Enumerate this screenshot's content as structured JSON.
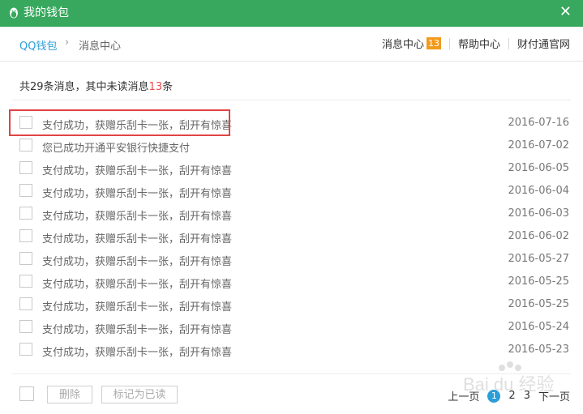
{
  "window": {
    "title": "我的钱包",
    "close_label": "✕"
  },
  "nav": {
    "breadcrumb": {
      "home": "QQ钱包",
      "sep": "›",
      "current": "消息中心"
    },
    "message_center": "消息中心",
    "message_badge": "13",
    "help_center": "帮助中心",
    "tenpay": "财付通官网"
  },
  "summary": {
    "prefix": "共29条消息，其中未读消息",
    "unread": "13",
    "suffix": "条"
  },
  "messages": [
    {
      "text": "支付成功，获赠乐刮卡一张，刮开有惊喜",
      "date": "2016-07-16"
    },
    {
      "text": "您已成功开通平安银行快捷支付",
      "date": "2016-07-02"
    },
    {
      "text": "支付成功，获赠乐刮卡一张，刮开有惊喜",
      "date": "2016-06-05"
    },
    {
      "text": "支付成功，获赠乐刮卡一张，刮开有惊喜",
      "date": "2016-06-04"
    },
    {
      "text": "支付成功，获赠乐刮卡一张，刮开有惊喜",
      "date": "2016-06-03"
    },
    {
      "text": "支付成功，获赠乐刮卡一张，刮开有惊喜",
      "date": "2016-06-02"
    },
    {
      "text": "支付成功，获赠乐刮卡一张，刮开有惊喜",
      "date": "2016-05-27"
    },
    {
      "text": "支付成功，获赠乐刮卡一张，刮开有惊喜",
      "date": "2016-05-25"
    },
    {
      "text": "支付成功，获赠乐刮卡一张，刮开有惊喜",
      "date": "2016-05-25"
    },
    {
      "text": "支付成功，获赠乐刮卡一张，刮开有惊喜",
      "date": "2016-05-24"
    },
    {
      "text": "支付成功，获赠乐刮卡一张，刮开有惊喜",
      "date": "2016-05-23"
    }
  ],
  "footer": {
    "delete_label": "删除",
    "mark_read_label": "标记为已读",
    "pager": {
      "prev": "上一页",
      "current": "1",
      "page2": "2",
      "page3": "3",
      "next": "下一页"
    }
  },
  "watermark": {
    "text": "Bai du 经验"
  },
  "colors": {
    "titlebar": "#37a85d",
    "link": "#2b9ed8",
    "badge": "#f39a1b",
    "unread": "#e84a4a",
    "highlight": "#e04545"
  }
}
